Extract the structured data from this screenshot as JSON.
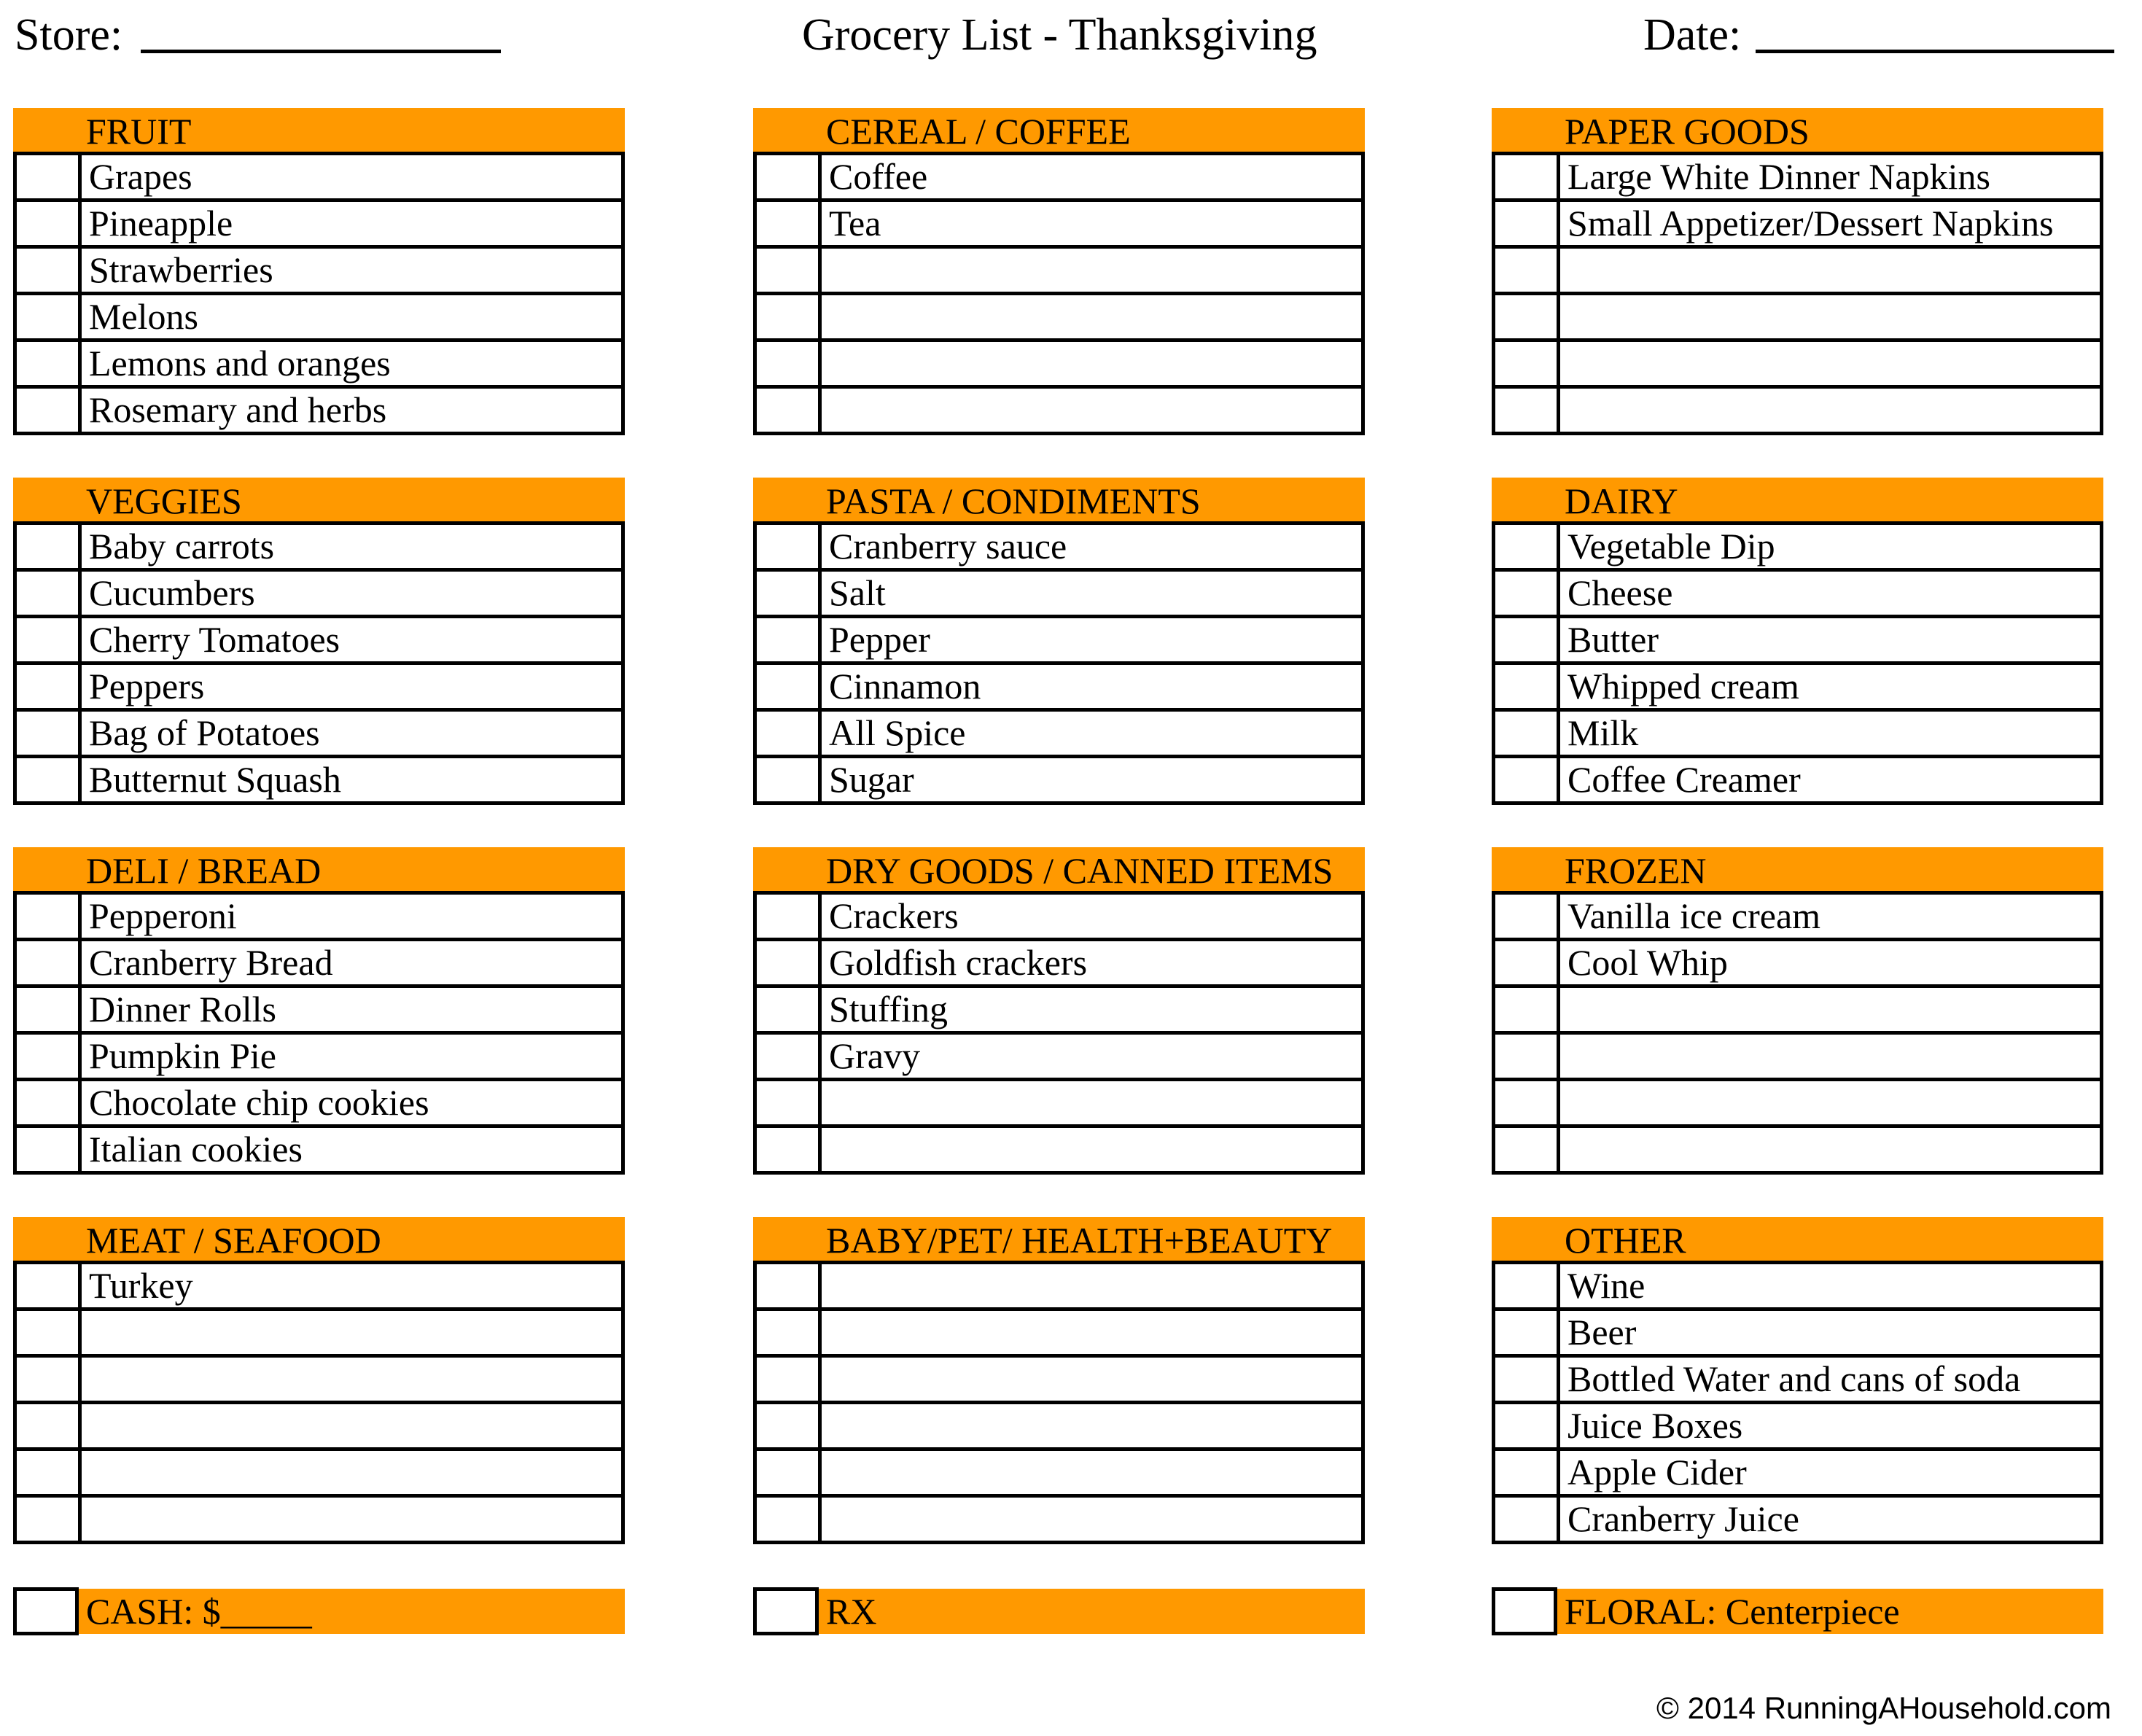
{
  "header": {
    "store_label": "Store:",
    "title": "Grocery List - Thanksgiving",
    "date_label": "Date:"
  },
  "accent_color": "#FF9900",
  "columns": [
    {
      "blocks": [
        {
          "title": "FRUIT",
          "items": [
            "Grapes",
            "Pineapple",
            "Strawberries",
            "Melons",
            "Lemons and oranges",
            "Rosemary and herbs"
          ]
        },
        {
          "title": "VEGGIES",
          "items": [
            "Baby carrots",
            "Cucumbers",
            "Cherry Tomatoes",
            "Peppers",
            "Bag of Potatoes",
            "Butternut Squash"
          ]
        },
        {
          "title": "DELI / BREAD",
          "items": [
            "Pepperoni",
            "Cranberry Bread",
            "Dinner Rolls",
            "Pumpkin Pie",
            "Chocolate chip cookies",
            "Italian cookies"
          ]
        },
        {
          "title": "MEAT / SEAFOOD",
          "items": [
            "Turkey",
            "",
            "",
            "",
            "",
            ""
          ]
        }
      ],
      "extra": {
        "label": "CASH: $_____"
      }
    },
    {
      "blocks": [
        {
          "title": "CEREAL / COFFEE",
          "items": [
            "Coffee",
            "Tea",
            "",
            "",
            "",
            ""
          ]
        },
        {
          "title": "PASTA / CONDIMENTS",
          "items": [
            "Cranberry sauce",
            "Salt",
            "Pepper",
            "Cinnamon",
            "All Spice",
            "Sugar"
          ]
        },
        {
          "title": "DRY GOODS / CANNED ITEMS",
          "items": [
            "Crackers",
            "Goldfish crackers",
            "Stuffing",
            "Gravy",
            "",
            ""
          ]
        },
        {
          "title": "BABY/PET/ HEALTH+BEAUTY",
          "items": [
            "",
            "",
            "",
            "",
            "",
            ""
          ]
        }
      ],
      "extra": {
        "label": "RX"
      }
    },
    {
      "blocks": [
        {
          "title": "PAPER GOODS",
          "items": [
            "Large White Dinner Napkins",
            "Small Appetizer/Dessert Napkins",
            "",
            "",
            "",
            ""
          ]
        },
        {
          "title": "DAIRY",
          "items": [
            "Vegetable Dip",
            "Cheese",
            "Butter",
            "Whipped cream",
            "Milk",
            "Coffee Creamer"
          ]
        },
        {
          "title": "FROZEN",
          "items": [
            "Vanilla ice cream",
            "Cool Whip",
            "",
            "",
            "",
            ""
          ]
        },
        {
          "title": "OTHER",
          "items": [
            "Wine",
            "Beer",
            "Bottled Water and cans of soda",
            "Juice Boxes",
            "Apple Cider",
            "Cranberry Juice"
          ]
        }
      ],
      "extra": {
        "label": "FLORAL: Centerpiece"
      }
    }
  ],
  "footer": {
    "copyright": "© 2014 RunningAHousehold.com"
  }
}
